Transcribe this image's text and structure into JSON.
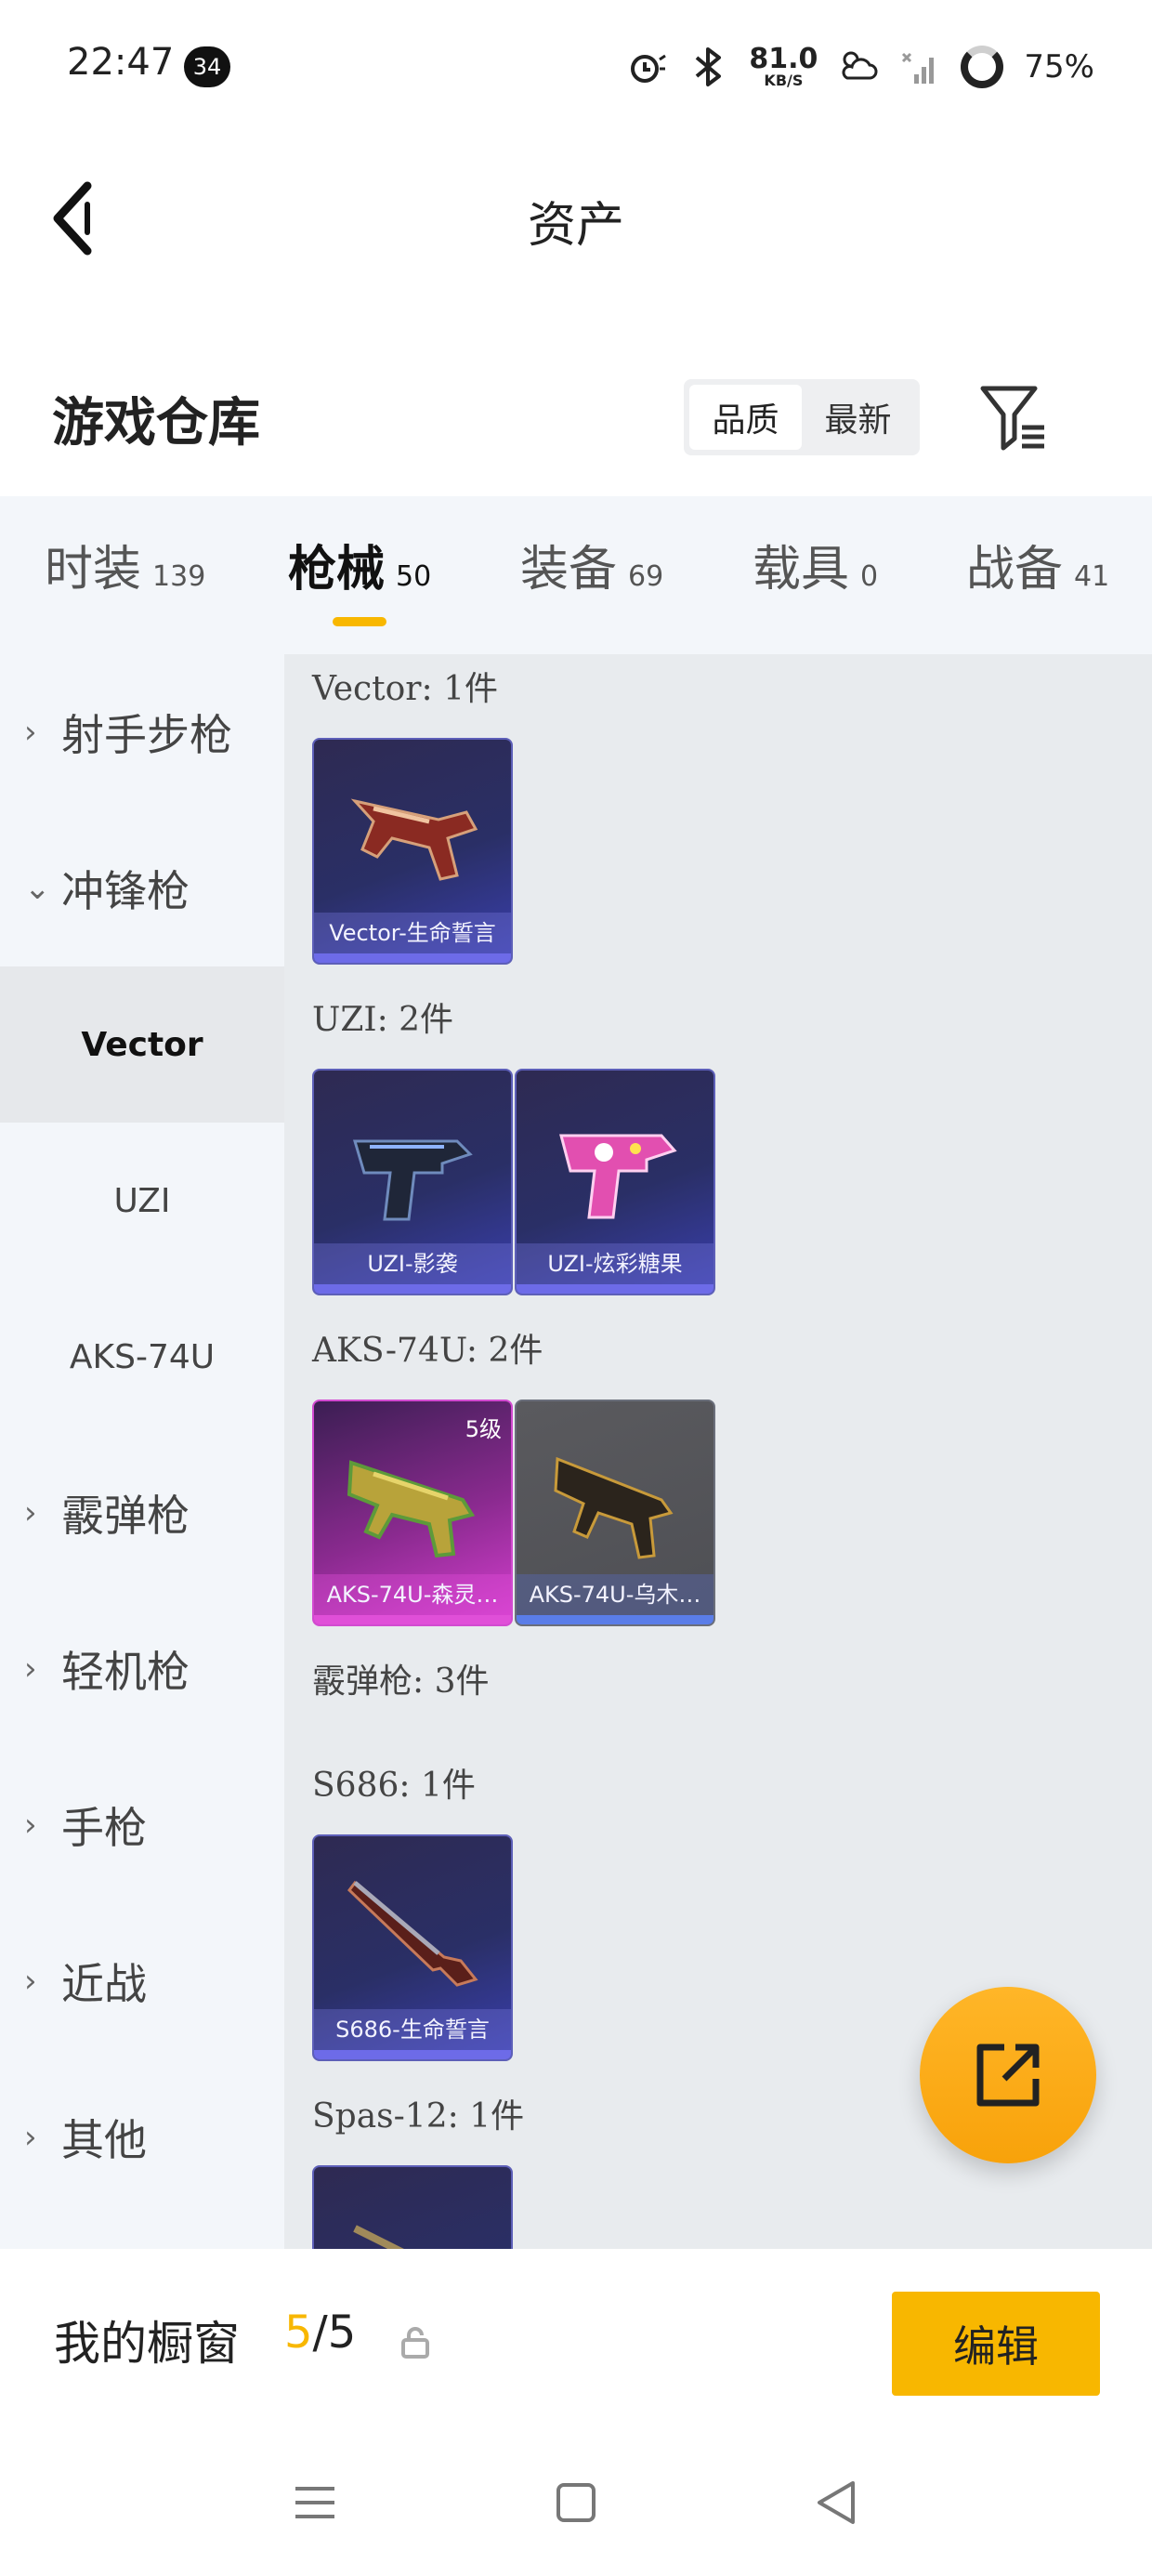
{
  "status_bar": {
    "time": "22:47",
    "notification_count": "34",
    "net_speed_value": "81.0",
    "net_speed_unit": "KB/S",
    "battery": "75%"
  },
  "header": {
    "title": "资产"
  },
  "warehouse": {
    "title": "游戏仓库",
    "sort_options": [
      "品质",
      "最新"
    ],
    "active_sort": "品质"
  },
  "tabs": [
    {
      "label": "时装",
      "count": "139"
    },
    {
      "label": "枪械",
      "count": "50"
    },
    {
      "label": "装备",
      "count": "69"
    },
    {
      "label": "载具",
      "count": "0"
    },
    {
      "label": "战备",
      "count": "41"
    }
  ],
  "active_tab": "枪械",
  "sidebar": {
    "categories": [
      {
        "label": "射手步枪",
        "expanded": false
      },
      {
        "label": "冲锋枪",
        "expanded": true
      },
      {
        "label": "霰弹枪",
        "expanded": false
      },
      {
        "label": "轻机枪",
        "expanded": false
      },
      {
        "label": "手枪",
        "expanded": false
      },
      {
        "label": "近战",
        "expanded": false
      },
      {
        "label": "其他",
        "expanded": false
      }
    ],
    "sub_items": [
      "Vector",
      "UZI",
      "AKS-74U"
    ],
    "selected_sub": "Vector"
  },
  "content": {
    "sections": [
      {
        "label": "Vector: 1件",
        "items": [
          {
            "caption": "Vector-生命誓言"
          }
        ]
      },
      {
        "label": "UZI: 2件",
        "items": [
          {
            "caption": "UZI-影袭"
          },
          {
            "caption": "UZI-炫彩糖果"
          }
        ]
      },
      {
        "label": "AKS-74U: 2件",
        "items": [
          {
            "caption": "AKS-74U-森灵…",
            "level": "5级"
          },
          {
            "caption": "AKS-74U-乌木…"
          }
        ]
      },
      {
        "label": "霰弹枪: 3件",
        "items": []
      },
      {
        "label": "S686: 1件",
        "items": [
          {
            "caption": "S686-生命誓言"
          }
        ]
      },
      {
        "label": "Spas-12: 1件",
        "items": [
          {}
        ]
      }
    ]
  },
  "showcase": {
    "label": "我的橱窗",
    "current": "5",
    "separator": "/",
    "total": "5",
    "edit_label": "编辑"
  },
  "colors": {
    "accent": "#f8b700",
    "fab": "#ffb628"
  }
}
